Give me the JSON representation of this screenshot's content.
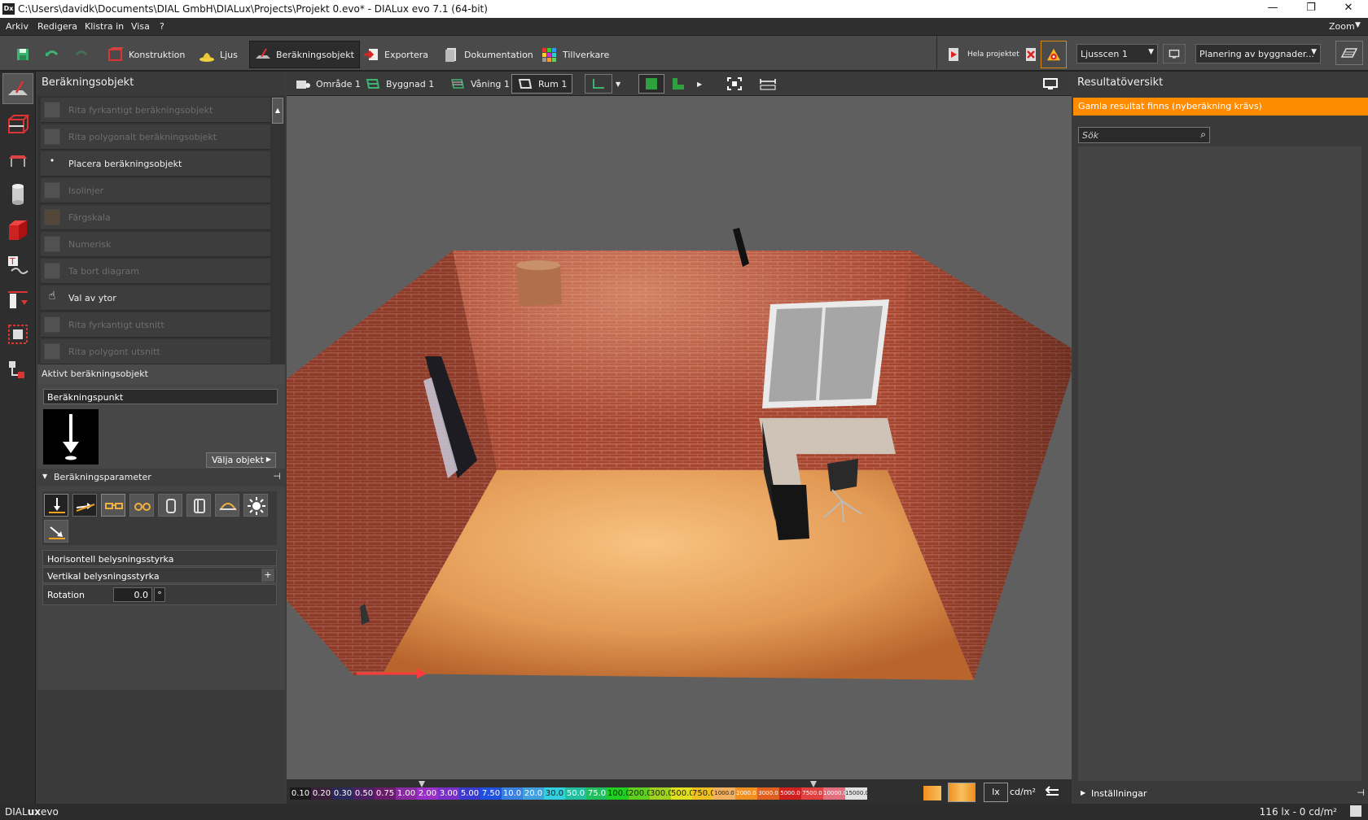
{
  "window": {
    "title": "C:\\Users\\davidk\\Documents\\DIAL GmbH\\DIALux\\Projects\\Projekt 0.evo* - DIALux evo 7.1  (64-bit)",
    "logo": "Dx",
    "minimize": "—",
    "restore": "❐",
    "close": "✕"
  },
  "menu": {
    "items": [
      "Arkiv",
      "Redigera",
      "Klistra in",
      "Visa",
      "?"
    ],
    "zoom": "Zoom"
  },
  "toolbar": {
    "tabs": [
      {
        "label": "Konstruktion"
      },
      {
        "label": "Ljus"
      },
      {
        "label": "Beräkningsobjekt"
      },
      {
        "label": "Exportera"
      },
      {
        "label": "Dokumentation"
      },
      {
        "label": "Tillverkare"
      }
    ],
    "hela_projektet": "Hela projektet",
    "light_scene": "Ljusscen 1",
    "planning": "Planering av byggnader..."
  },
  "left_panel": {
    "title": "Beräkningsobjekt",
    "items": [
      {
        "label": "Rita fyrkantigt beräkningsobjekt",
        "enabled": false
      },
      {
        "label": "Rita polygonalt beräkningsobjekt",
        "enabled": false
      },
      {
        "label": "Placera beräkningsobjekt",
        "enabled": true
      },
      {
        "label": "Isolinjer",
        "enabled": false
      },
      {
        "label": "Färgskala",
        "enabled": false
      },
      {
        "label": "Numerisk",
        "enabled": false
      },
      {
        "label": "Ta bort diagram",
        "enabled": false
      },
      {
        "label": "Val av ytor",
        "enabled": true
      },
      {
        "label": "Rita fyrkantigt utsnitt",
        "enabled": false
      },
      {
        "label": "Rita polygont utsnitt",
        "enabled": false
      }
    ],
    "active_title": "Aktivt beräkningsobjekt",
    "active_object": "Beräkningspunkt",
    "choose_button": "Välja objekt",
    "params_title": "Beräkningsparameter",
    "param_horizontal": "Horisontell belysningsstyrka",
    "param_vertical": "Vertikal belysningsstyrka",
    "rotation_label": "Rotation",
    "rotation_value": "0.0",
    "rotation_unit": "°"
  },
  "view_toolbar": {
    "items": [
      "Område 1",
      "Byggnad 1",
      "Våning 1",
      "Rum 1"
    ]
  },
  "color_scale": {
    "values": [
      "0.10",
      "0.20",
      "0.30",
      "0.50",
      "0.75",
      "1.00",
      "2.00",
      "3.00",
      "5.00",
      "7.50",
      "10.0",
      "20.0",
      "30.0",
      "50.0",
      "75.0",
      "100.0",
      "200.0",
      "300.0",
      "500.0",
      "750.0",
      "1000.0",
      "2000.0",
      "3000.0",
      "5000.0",
      "7500.0",
      "10000.0",
      "15000.0"
    ],
    "colors": [
      "#1a1a1a",
      "#3a1f3a",
      "#2a2a5a",
      "#4a2060",
      "#6a1a6a",
      "#8a2aa0",
      "#9a30c8",
      "#7a30c8",
      "#3a3ad0",
      "#2050e0",
      "#3a80e0",
      "#40a0e0",
      "#30d0e0",
      "#20c0a0",
      "#20c060",
      "#20d020",
      "#60d020",
      "#a0d020",
      "#e0e020",
      "#f0c020",
      "#f0b060",
      "#f09020",
      "#e06020",
      "#d02020",
      "#e04040",
      "#e07080",
      "#e0e0e0"
    ],
    "unit_lx": "lx",
    "unit_cd": "cd/m²"
  },
  "right_panel": {
    "title": "Resultatöversikt",
    "warning": "Gamla resultat finns (nyberäkning krävs)",
    "search_placeholder": "Sök",
    "settings": "Inställningar"
  },
  "status": {
    "brand_a": "DIAL",
    "brand_b": "ux",
    "brand_c": "evo",
    "readout": "116 lx - 0 cd/m²"
  },
  "colors": {
    "accent_orange": "#ff8c00",
    "brick": "#a8452f",
    "floor": "#e8a35c"
  }
}
